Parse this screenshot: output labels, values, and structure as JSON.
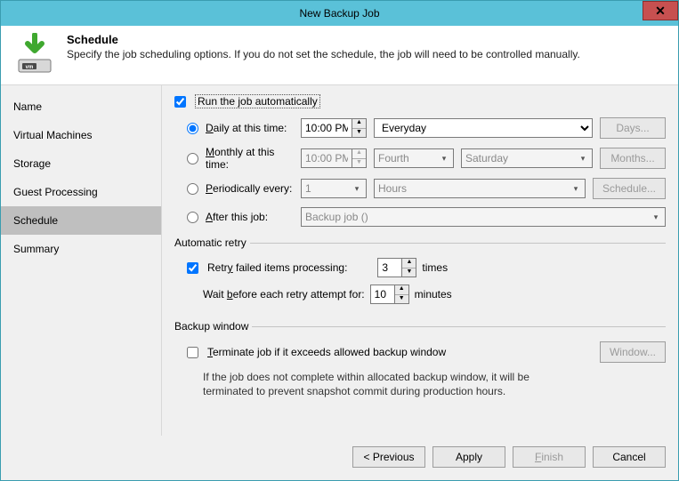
{
  "window": {
    "title": "New Backup Job"
  },
  "header": {
    "title": "Schedule",
    "subtitle": "Specify the job scheduling options. If you do not set the schedule, the job will need to be controlled manually."
  },
  "sidebar": {
    "items": [
      {
        "label": "Name"
      },
      {
        "label": "Virtual Machines"
      },
      {
        "label": "Storage"
      },
      {
        "label": "Guest Processing"
      },
      {
        "label": "Schedule"
      },
      {
        "label": "Summary"
      }
    ]
  },
  "schedule": {
    "run_auto_label": "Run the job automatically",
    "run_auto_checked": true,
    "daily": {
      "label_pre": "D",
      "label_rest": "aily at this time:",
      "time": "10:00 PM",
      "recurrence": "Everyday",
      "days_btn": "Days..."
    },
    "monthly": {
      "label_pre": "M",
      "label_rest": "onthly at this time:",
      "time": "10:00 PM",
      "ordinal": "Fourth",
      "weekday": "Saturday",
      "months_btn": "Months..."
    },
    "periodic": {
      "label_pre": "P",
      "label_rest": "eriodically every:",
      "value": "1",
      "unit": "Hours",
      "schedule_btn": "Schedule..."
    },
    "after": {
      "label_pre": "A",
      "label_rest": "fter this job:",
      "job": "Backup job ()"
    }
  },
  "retry": {
    "legend": "Automatic retry",
    "retry_label_pre": "Retr",
    "retry_label_u": "y",
    "retry_label_post": " failed items processing:",
    "retry_checked": true,
    "count": "3",
    "count_suffix": "times",
    "wait_label_pre": "Wait ",
    "wait_label_u": "b",
    "wait_label_post": "efore each retry attempt for:",
    "wait": "10",
    "wait_suffix": "minutes"
  },
  "window_section": {
    "legend": "Backup window",
    "terminate_label_pre": "T",
    "terminate_label_rest": "erminate job if it exceeds allowed backup window",
    "terminate_checked": false,
    "window_btn": "Window...",
    "help": "If the job does not complete within allocated backup window, it will be terminated to prevent snapshot commit during production hours."
  },
  "footer": {
    "previous": "< Previous",
    "apply": "Apply",
    "finish_pre": "F",
    "finish_rest": "inish",
    "cancel": "Cancel"
  }
}
